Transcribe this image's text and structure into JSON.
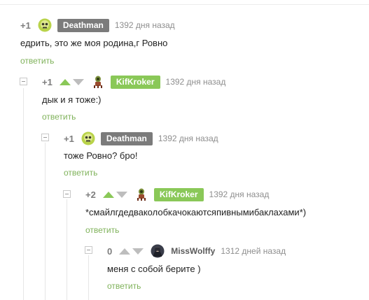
{
  "comments": [
    {
      "rating": "+1",
      "author": "Deathman",
      "author_style": "grey",
      "date": "1392 дня назад",
      "text": "едрить, это же моя родина,г Ровно",
      "reply_label": "ответить",
      "avatar_icon": "green-skull-avatar",
      "has_vote_arrows": false,
      "has_collapse": false
    },
    {
      "rating": "+1",
      "author": "KifKroker",
      "author_style": "green",
      "date": "1392 дня назад",
      "text": "дык и я тоже:)",
      "reply_label": "ответить",
      "avatar_icon": "kif-avatar",
      "has_vote_arrows": true,
      "has_collapse": true
    },
    {
      "rating": "+1",
      "author": "Deathman",
      "author_style": "grey",
      "date": "1392 дня назад",
      "text": "тоже Ровно? бро!",
      "reply_label": "ответить",
      "avatar_icon": "green-skull-avatar",
      "has_vote_arrows": false,
      "has_collapse": true
    },
    {
      "rating": "+2",
      "author": "KifKroker",
      "author_style": "green",
      "date": "1392 дня назад",
      "text": "*смайлгдедваколобкачокаютсяпивнымибаклахами*)",
      "reply_label": "ответить",
      "avatar_icon": "kif-avatar",
      "has_vote_arrows": true,
      "has_collapse": true
    },
    {
      "rating": "0",
      "author": "MissWolffy",
      "author_style": "plain",
      "date": "1312 дней назад",
      "text": "меня с собой берите )",
      "reply_label": "ответить",
      "avatar_icon": "dark-portrait-avatar",
      "has_vote_arrows": true,
      "has_collapse": true
    }
  ],
  "colors": {
    "accent_green": "#8ac858",
    "reply_link": "#7fb25a",
    "nick_grey": "#7b7b7b"
  }
}
